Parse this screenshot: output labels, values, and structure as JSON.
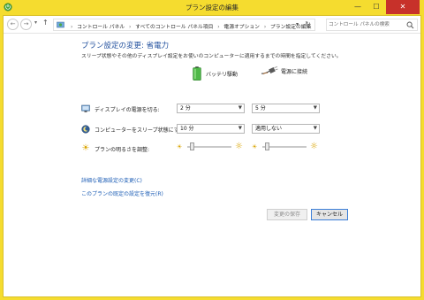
{
  "window": {
    "title": "プラン設定の編集",
    "minimize": "—",
    "maximize": "☐",
    "close": "✕"
  },
  "addressbar": {
    "back": "←",
    "forward": "→",
    "up": "↑",
    "breadcrumbs": [
      "コントロール パネル",
      "すべてのコントロール パネル項目",
      "電源オプション",
      "プラン設定の編集"
    ],
    "search_placeholder": "コントロール パネルの検索"
  },
  "main": {
    "title": "プラン設定の変更: 省電力",
    "description": "スリープ状態やその他のディスプレイ設定をお使いのコンピューターに適用するまでの時間を指定してください。",
    "columns": {
      "battery": "バッテリ駆動",
      "plugged": "電源に接続"
    },
    "rows": {
      "display": {
        "label": "ディスプレイの電源を切る:",
        "battery_value": "2 分",
        "plugged_value": "5 分"
      },
      "sleep": {
        "label": "コンピューターをスリープ状態にする:",
        "battery_value": "10 分",
        "plugged_value": "適用しない"
      },
      "brightness": {
        "label": "プランの明るさを調整:",
        "battery_level": 0.1,
        "plugged_level": 0.1
      }
    },
    "links": {
      "advanced": "詳細な電源設定の変更(C)",
      "restore": "このプランの既定の設定を復元(R)"
    },
    "buttons": {
      "save": "変更の保存",
      "cancel": "キャンセル"
    }
  },
  "colors": {
    "accent_title": "#1f4e9c",
    "link": "#1f5fb6",
    "window_frame": "#f5dc2f",
    "close_button": "#c7312a"
  },
  "icons": {
    "app": "power-options-icon",
    "display": "monitor-icon",
    "sleep": "moon-icon",
    "brightness": "sun-icon",
    "battery": "battery-icon",
    "plugged": "power-plug-icon",
    "search": "search-icon",
    "refresh": "refresh-icon"
  }
}
